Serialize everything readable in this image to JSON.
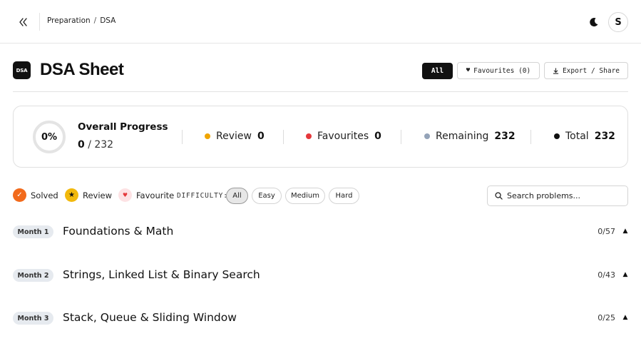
{
  "breadcrumb": {
    "parent": "Preparation",
    "separator": "/",
    "current": "DSA"
  },
  "user": {
    "initial": "S"
  },
  "page": {
    "logo_text": "DSA",
    "title": "DSA Sheet"
  },
  "actions": {
    "all_label": "All",
    "favourites_label": "Favourites (0)",
    "export_label": "Export / Share"
  },
  "progress": {
    "percent_label": "0%",
    "percent_value": 0,
    "title": "Overall Progress",
    "solved": "0",
    "total_label": "/ 232",
    "stats": [
      {
        "label": "Review",
        "value": "0",
        "color": "#f0a500"
      },
      {
        "label": "Favourites",
        "value": "0",
        "color": "#e5383b"
      },
      {
        "label": "Remaining",
        "value": "232",
        "color": "#94a3b8"
      },
      {
        "label": "Total",
        "value": "232",
        "color": "#111111"
      }
    ]
  },
  "legend": {
    "solved": "Solved",
    "review": "Review",
    "favourite": "Favourite",
    "colors": {
      "solved": "#f26a1b",
      "review": "#f2b90c",
      "favourite": "#fde2e4"
    }
  },
  "filters": {
    "label": "DIFFICULTY:",
    "options": [
      "All",
      "Easy",
      "Medium",
      "Hard"
    ],
    "selected": "All"
  },
  "search": {
    "placeholder": "Search problems..."
  },
  "months": [
    {
      "badge": "Month 1",
      "title": "Foundations & Math",
      "count": "0/57"
    },
    {
      "badge": "Month 2",
      "title": "Strings, Linked List & Binary Search",
      "count": "0/43"
    },
    {
      "badge": "Month 3",
      "title": "Stack, Queue & Sliding Window",
      "count": "0/25"
    }
  ]
}
